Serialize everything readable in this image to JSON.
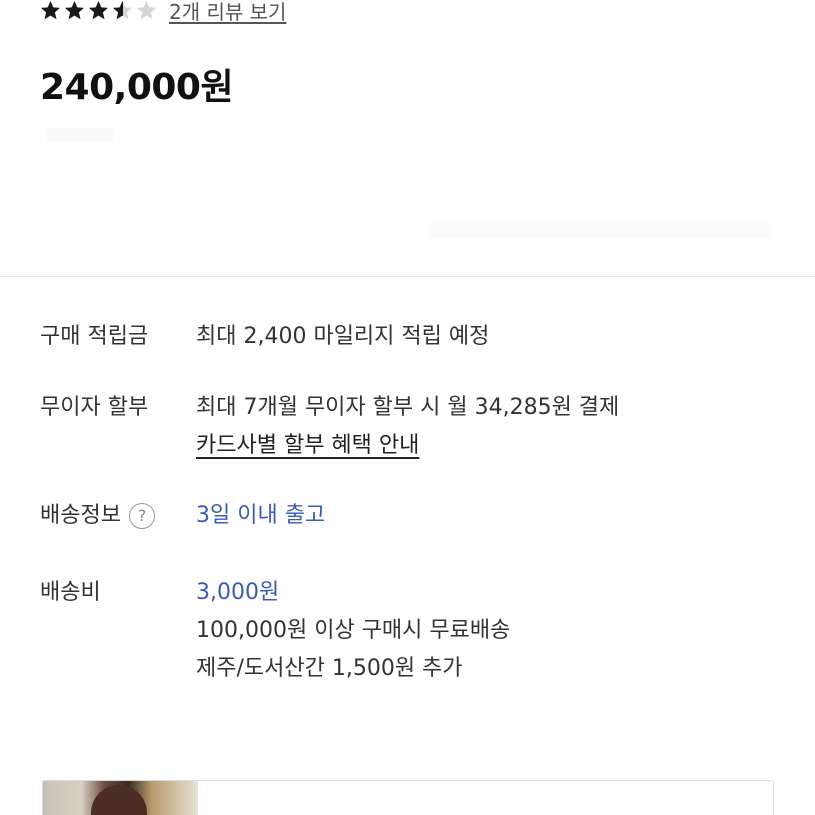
{
  "rating": {
    "value": 3.5,
    "max": 5,
    "filled_color": "#1a1a1a",
    "empty_color": "#d6d6d6",
    "review_link": "2개 리뷰 보기"
  },
  "price": "240,000원",
  "info": {
    "points": {
      "label": "구매 적립금",
      "value": "최대 2,400 마일리지 적립 예정"
    },
    "installment": {
      "label": "무이자 할부",
      "value": "최대 7개월 무이자 할부 시 월 34,285원 결제",
      "link": "카드사별 할부 혜택 안내"
    },
    "shipping_info": {
      "label": "배송정보",
      "help_icon": "question-circle-icon",
      "help_glyph": "?",
      "value": "3일 이내 출고"
    },
    "shipping_fee": {
      "label": "배송비",
      "value": "3,000원",
      "free_condition": "100,000원 이상 구매시 무료배송",
      "extra": "제주/도서산간 1,500원 추가"
    }
  },
  "colors": {
    "accent": "#3b5bb5",
    "text": "#333333",
    "divider": "#e9e9e9"
  }
}
